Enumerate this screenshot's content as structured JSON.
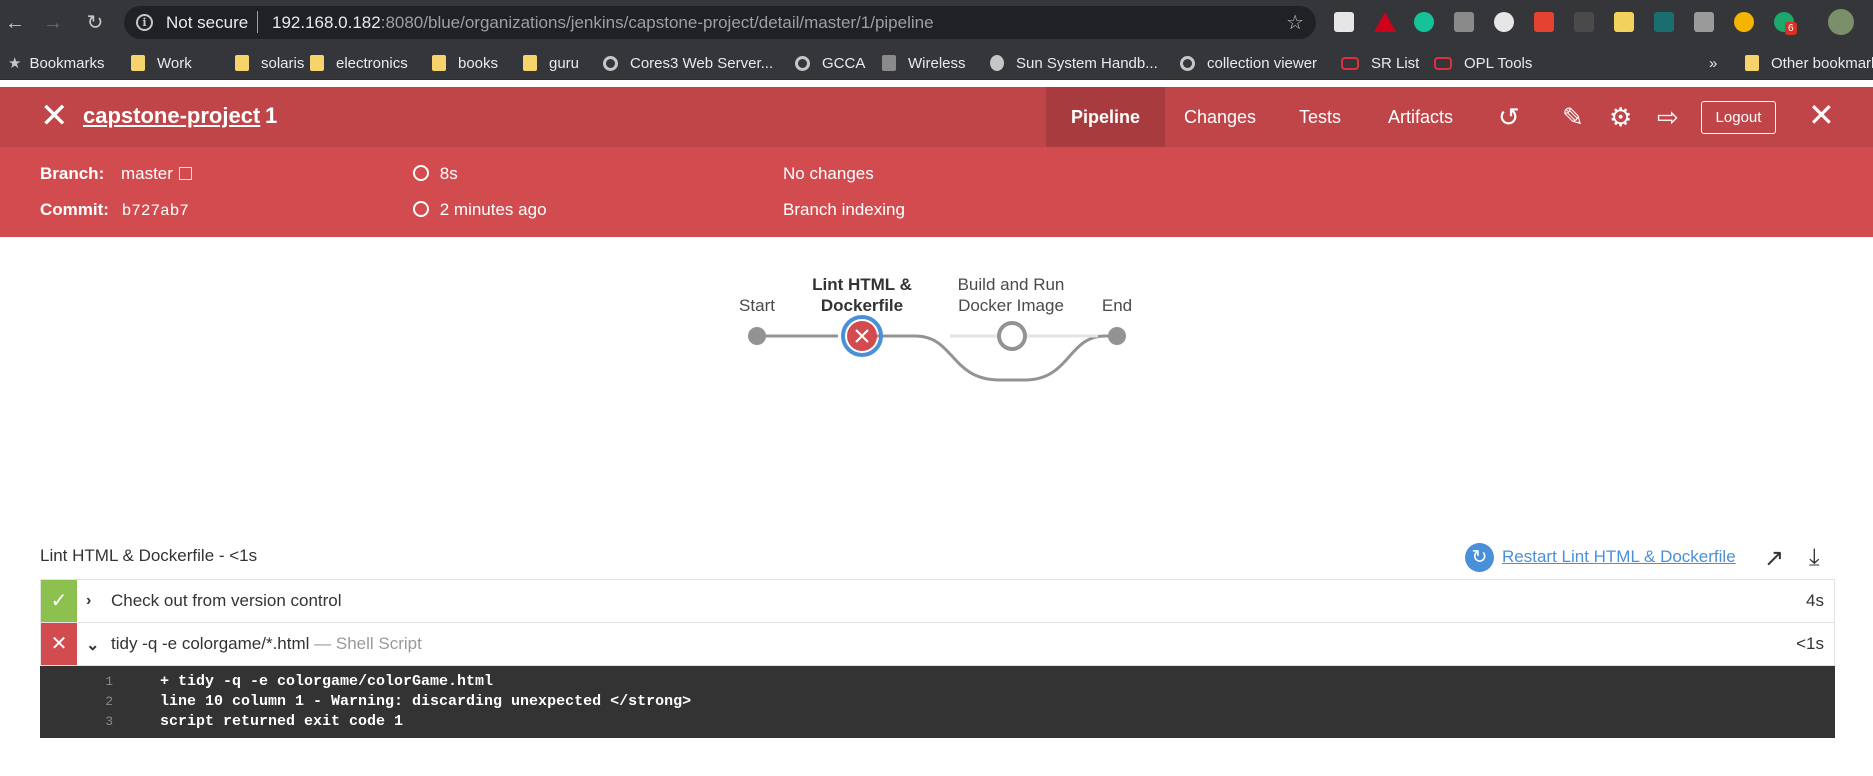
{
  "browser": {
    "security_label": "Not secure",
    "url_host": "192.168.0.182",
    "url_rest": ":8080/blue/organizations/jenkins/capstone-project/detail/master/1/pipeline",
    "bookmarks": [
      {
        "label": "Bookmarks",
        "icon": "star-icon"
      },
      {
        "label": "Work",
        "icon": "folder-icon"
      },
      {
        "label": "solaris",
        "icon": "folder-icon"
      },
      {
        "label": "electronics",
        "icon": "folder-icon"
      },
      {
        "label": "books",
        "icon": "folder-icon"
      },
      {
        "label": "guru",
        "icon": "folder-icon"
      },
      {
        "label": "Cores3 Web Server...",
        "icon": "globe-icon"
      },
      {
        "label": "GCCA",
        "icon": "globe-icon"
      },
      {
        "label": "Wireless",
        "icon": "wireless-icon"
      },
      {
        "label": "Sun System Handb...",
        "icon": "sun-icon"
      },
      {
        "label": "collection viewer",
        "icon": "globe-icon"
      },
      {
        "label": "SR List",
        "icon": "oracle-icon"
      },
      {
        "label": "OPL Tools",
        "icon": "oracle-icon"
      },
      {
        "label": "»",
        "icon": "overflow-icon"
      },
      {
        "label": "Other bookmarks",
        "icon": "folder-icon"
      }
    ],
    "extension_badge": "6"
  },
  "header": {
    "project": "capstone-project",
    "run_number": "1",
    "tabs": [
      "Pipeline",
      "Changes",
      "Tests",
      "Artifacts"
    ],
    "active_tab": "Pipeline",
    "logout_label": "Logout"
  },
  "summary": {
    "branch_label": "Branch:",
    "branch_value": "master",
    "commit_label": "Commit:",
    "commit_value": "b727ab7",
    "duration": "8s",
    "time_ago": "2 minutes ago",
    "changes": "No changes",
    "cause": "Branch indexing"
  },
  "pipeline": {
    "stages": [
      {
        "line1": "Start",
        "line2": "",
        "status": "start"
      },
      {
        "line1": "Lint HTML &",
        "line2": "Dockerfile",
        "status": "failed"
      },
      {
        "line1": "Build and Run",
        "line2": "Docker Image",
        "status": "not-built"
      },
      {
        "line1": "End",
        "line2": "",
        "status": "end"
      }
    ],
    "colors": {
      "failed": "#d24b4f",
      "selected_ring": "#4a90d9",
      "line": "#949393",
      "pending_line": "#e3e3e3"
    }
  },
  "steps_panel": {
    "title": "Lint HTML & Dockerfile - <1s",
    "restart_label": "Restart Lint HTML & Dockerfile",
    "steps": [
      {
        "name": "Check out from version control",
        "type": "",
        "duration": "4s",
        "status": "success",
        "expanded": false
      },
      {
        "name": "tidy -q -e colorgame/*.html",
        "type": "— Shell Script",
        "duration": "<1s",
        "status": "failure",
        "expanded": true
      }
    ],
    "log": [
      {
        "num": "1",
        "text": "+ tidy -q -e colorgame/colorGame.html"
      },
      {
        "num": "2",
        "text": "line 10 column 1 - Warning: discarding unexpected </strong>"
      },
      {
        "num": "3",
        "text": "script returned exit code 1"
      }
    ]
  }
}
